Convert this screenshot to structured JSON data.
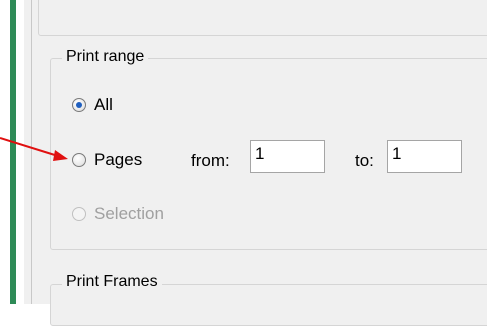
{
  "print_range": {
    "legend": "Print range",
    "options": [
      {
        "label": "All",
        "checked": true,
        "disabled": false
      },
      {
        "label": "Pages",
        "checked": false,
        "disabled": false
      },
      {
        "label": "Selection",
        "checked": false,
        "disabled": true
      }
    ],
    "from_label": "from:",
    "from_value": "1",
    "to_label": "to:",
    "to_value": "1"
  },
  "print_frames": {
    "legend": "Print Frames"
  },
  "colors": {
    "annotation_arrow": "#e01010",
    "accent_bar": "#2e8b57",
    "radio_checked": "#1f5fbf"
  }
}
